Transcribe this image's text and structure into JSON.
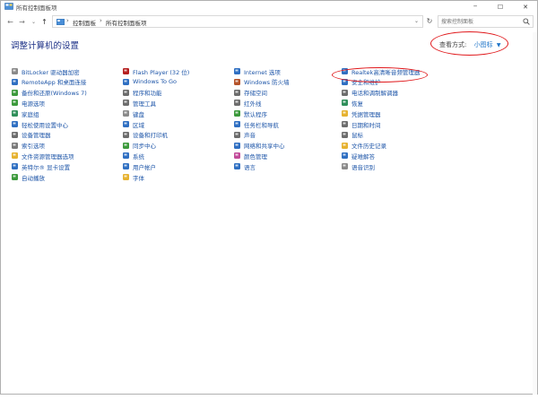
{
  "window": {
    "title": "所有控制面板项",
    "minimize_glyph": "─",
    "maximize_glyph": "☐",
    "close_glyph": "✕"
  },
  "address": {
    "crumbs": [
      "控制面板",
      "所有控制面板项"
    ],
    "separator": "›",
    "search_placeholder": "搜索控制面板"
  },
  "header": {
    "title": "调整计算机的设置",
    "view_by_label": "查看方式:",
    "view_by_value": "小图标"
  },
  "columns": [
    [
      {
        "label": "BitLocker 驱动器加密",
        "icon": "bitlocker-icon",
        "color": "#8a8a8a"
      },
      {
        "label": "RemoteApp 和桌面连接",
        "icon": "remoteapp-icon",
        "color": "#2f6fc2"
      },
      {
        "label": "备份和还原(Windows 7)",
        "icon": "backup-icon",
        "color": "#3c9a3c"
      },
      {
        "label": "电源选项",
        "icon": "power-icon",
        "color": "#3c9a3c"
      },
      {
        "label": "家庭组",
        "icon": "homegroup-icon",
        "color": "#2f8f5a"
      },
      {
        "label": "轻松使用设置中心",
        "icon": "ease-of-access-icon",
        "color": "#2f6fc2"
      },
      {
        "label": "设备管理器",
        "icon": "device-manager-icon",
        "color": "#6d6d6d"
      },
      {
        "label": "索引选项",
        "icon": "indexing-icon",
        "color": "#7a7a7a"
      },
      {
        "label": "文件资源管理器选项",
        "icon": "folder-options-icon",
        "color": "#e6b230"
      },
      {
        "label": "英特尔® 显卡设置",
        "icon": "intel-graphics-icon",
        "color": "#2f6fc2"
      },
      {
        "label": "自动播放",
        "icon": "autoplay-icon",
        "color": "#3c9a3c"
      }
    ],
    [
      {
        "label": "Flash Player (32 位)",
        "icon": "flash-icon",
        "color": "#b51f1f"
      },
      {
        "label": "Windows To Go",
        "icon": "windows-to-go-icon",
        "color": "#2f6fc2"
      },
      {
        "label": "程序和功能",
        "icon": "programs-icon",
        "color": "#6d6d6d"
      },
      {
        "label": "管理工具",
        "icon": "admin-tools-icon",
        "color": "#6d6d6d"
      },
      {
        "label": "键盘",
        "icon": "keyboard-icon",
        "color": "#8a8a8a"
      },
      {
        "label": "区域",
        "icon": "region-icon",
        "color": "#2f6fc2"
      },
      {
        "label": "设备和打印机",
        "icon": "printer-icon",
        "color": "#6d6d6d"
      },
      {
        "label": "同步中心",
        "icon": "sync-center-icon",
        "color": "#3c9a3c"
      },
      {
        "label": "系统",
        "icon": "system-icon",
        "color": "#2f6fc2"
      },
      {
        "label": "用户帐户",
        "icon": "user-accounts-icon",
        "color": "#2f6fc2"
      },
      {
        "label": "字体",
        "icon": "fonts-icon",
        "color": "#e6b230"
      }
    ],
    [
      {
        "label": "Internet 选项",
        "icon": "internet-options-icon",
        "color": "#2f6fc2"
      },
      {
        "label": "Windows 防火墙",
        "icon": "firewall-icon",
        "color": "#b5532a"
      },
      {
        "label": "存储空间",
        "icon": "storage-spaces-icon",
        "color": "#6d6d6d"
      },
      {
        "label": "红外线",
        "icon": "infrared-icon",
        "color": "#6d6d6d"
      },
      {
        "label": "默认程序",
        "icon": "default-programs-icon",
        "color": "#3c9a3c"
      },
      {
        "label": "任务栏和导航",
        "icon": "taskbar-icon",
        "color": "#2f6fc2"
      },
      {
        "label": "声音",
        "icon": "sound-icon",
        "color": "#6d6d6d"
      },
      {
        "label": "网络和共享中心",
        "icon": "network-icon",
        "color": "#2f6fc2"
      },
      {
        "label": "颜色管理",
        "icon": "color-management-icon",
        "color": "#c24b9a"
      },
      {
        "label": "语言",
        "icon": "language-icon",
        "color": "#2f6fc2"
      }
    ],
    [
      {
        "label": "Realtek高清晰音频管理器",
        "icon": "realtek-audio-icon",
        "color": "#2f6fc2"
      },
      {
        "label": "安全和维护",
        "icon": "security-maintenance-icon",
        "color": "#2f6fc2"
      },
      {
        "label": "电话和调制解调器",
        "icon": "phone-modem-icon",
        "color": "#6d6d6d"
      },
      {
        "label": "恢复",
        "icon": "recovery-icon",
        "color": "#2f8f5a"
      },
      {
        "label": "凭据管理器",
        "icon": "credential-manager-icon",
        "color": "#e6b230"
      },
      {
        "label": "日期和时间",
        "icon": "date-time-icon",
        "color": "#6d6d6d"
      },
      {
        "label": "鼠标",
        "icon": "mouse-icon",
        "color": "#6d6d6d"
      },
      {
        "label": "文件历史记录",
        "icon": "file-history-icon",
        "color": "#e6b230"
      },
      {
        "label": "疑难解答",
        "icon": "troubleshooting-icon",
        "color": "#2f6fc2"
      },
      {
        "label": "语音识别",
        "icon": "speech-recognition-icon",
        "color": "#8a8a8a"
      }
    ]
  ],
  "colors": {
    "link": "#1d55a8",
    "title": "#1e3287",
    "accent": "#1e74c8",
    "annotation": "#e0181b"
  }
}
